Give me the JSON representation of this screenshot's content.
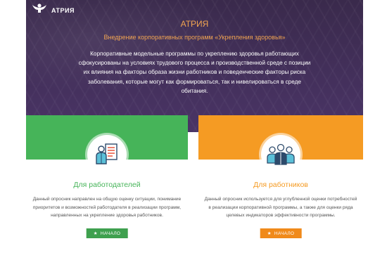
{
  "brand": {
    "logo_text": "АТРИЯ"
  },
  "hero": {
    "title": "АТРИЯ",
    "subtitle": "Внедрение корпоративных программ «Укрепления здоровья»",
    "description": "Корпоративные модельные программы по укреплению здоровья работающих сфокусированы на условиях трудового процесса и производственной среде с позиции их влияния на факторы образа жизни работников и поведенческие факторы риска заболевания, которые могут как формироваться, так и нивелироваться в среде обитания."
  },
  "cards": [
    {
      "title": "Для работодателей",
      "text": "Данный опросник направлен на общую оценку ситуации, понимание приоритетов и возможностей работодателя в реализации программ, направленных на укрепление здоровья работников.",
      "button_label": "НАЧАЛО",
      "icon": "employer-checklist-icon",
      "color": "#46b459"
    },
    {
      "title": "Для работников",
      "text": "Данный опросник используется для углубленной оценки потребностей в реализации корпоративной программы, а также для оценки ряда целевых индикаторов эффективности программы.",
      "button_label": "НАЧАЛО",
      "icon": "employees-group-icon",
      "color": "#f59b23"
    }
  ],
  "colors": {
    "accent_orange": "#f1a451",
    "hero_bg": "#3a2a4c"
  }
}
